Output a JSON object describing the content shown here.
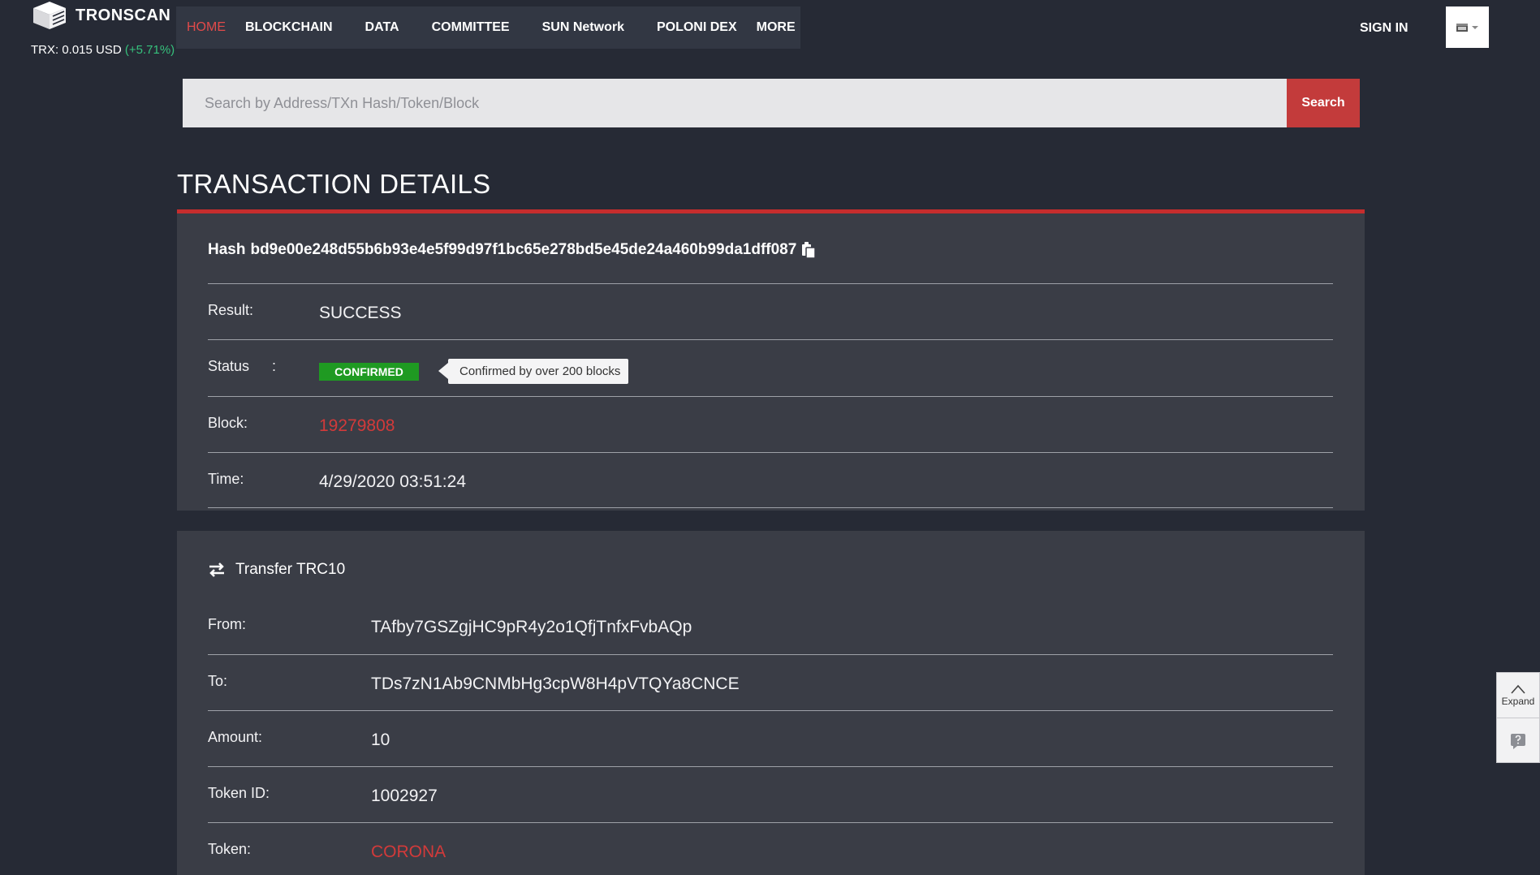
{
  "header": {
    "brand": "TRONSCAN",
    "price_text": "TRX: 0.015 USD",
    "price_change": "(+5.71%)",
    "nav": [
      "HOME",
      "BLOCKCHAIN",
      "DATA",
      "COMMITTEE",
      "SUN Network",
      "POLONI DEX",
      "MORE"
    ],
    "active_nav": "HOME",
    "signin": "SIGN IN"
  },
  "search": {
    "placeholder": "Search by Address/TXn Hash/Token/Block",
    "button": "Search"
  },
  "page_title": "TRANSACTION DETAILS",
  "transaction": {
    "hash_label": "Hash",
    "hash": "bd9e00e248d55b6b93e4e5f99d97f1bc65e278bd5e45de24a460b99da1dff087",
    "result_label": "Result:",
    "result": "SUCCESS",
    "status_label": "Status",
    "status_colon": ":",
    "status": "CONFIRMED",
    "status_tooltip": "Confirmed by over 200 blocks",
    "block_label": "Block:",
    "block": "19279808",
    "time_label": "Time:",
    "time": "4/29/2020 03:51:24"
  },
  "transfer": {
    "title": "Transfer TRC10",
    "from_label": "From:",
    "from": "TAfby7GSZgjHC9pR4y2o1QfjTnfxFvbAQp",
    "to_label": "To:",
    "to": "TDs7zN1Ab9CNMbHg3cpW8H4pVTQYa8CNCE",
    "amount_label": "Amount:",
    "amount": "10",
    "token_id_label": "Token ID:",
    "token_id": "1002927",
    "token_label": "Token:",
    "token": "CORONA"
  },
  "side_widget": {
    "expand": "Expand"
  },
  "colors": {
    "background": "#262a35",
    "card": "#3a3d46",
    "accent_red": "#c62d2d",
    "confirmed_green": "#1f9a22",
    "price_up": "#36c07c"
  },
  "icons": [
    "tronscan-logo-icon",
    "globe-flag-icon",
    "copy-icon",
    "transfer-arrows-icon",
    "chevron-up-icon",
    "help-icon"
  ]
}
